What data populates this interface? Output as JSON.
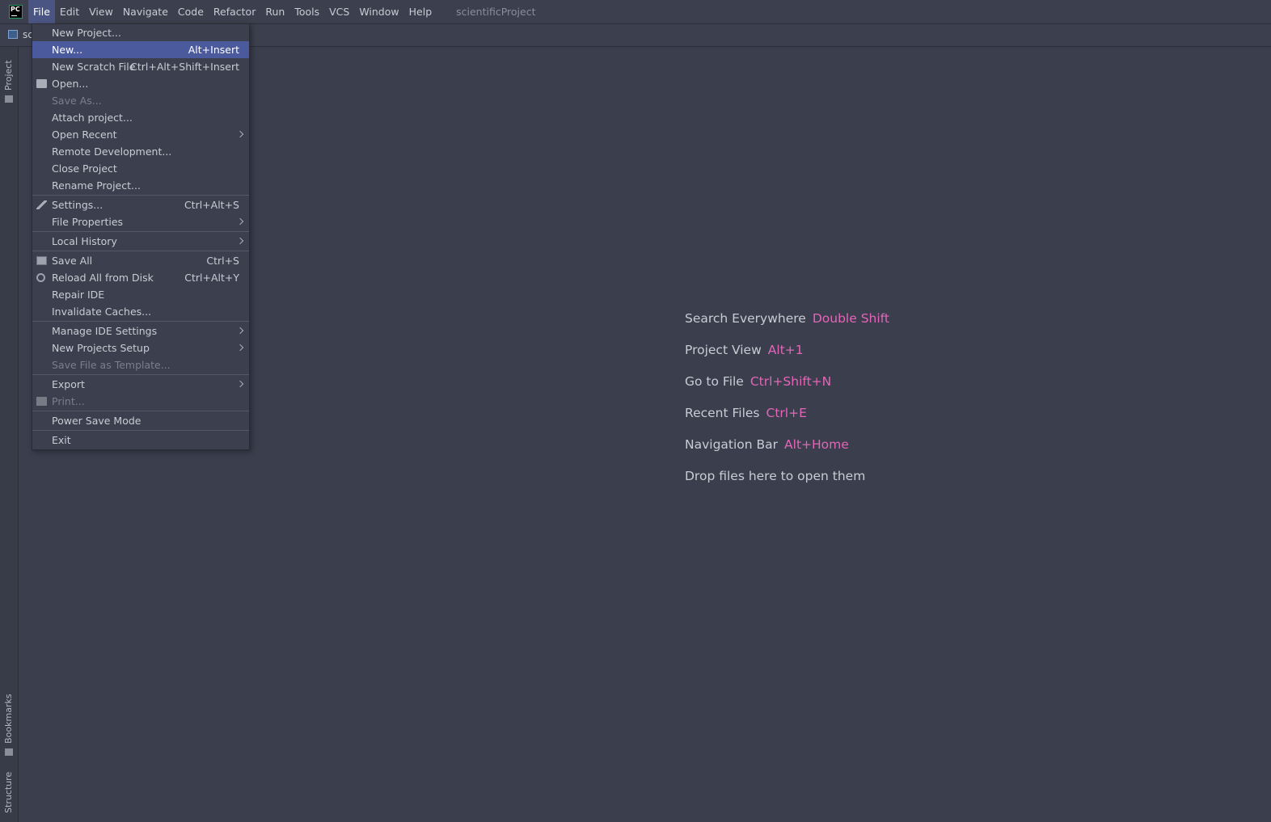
{
  "menubar": {
    "logo_text": "PC",
    "items": [
      "File",
      "Edit",
      "View",
      "Navigate",
      "Code",
      "Refactor",
      "Run",
      "Tools",
      "VCS",
      "Window",
      "Help"
    ],
    "project_title": "scientificProject"
  },
  "navbar": {
    "crumb": "sc"
  },
  "side_tabs": {
    "project": "Project",
    "bookmarks": "Bookmarks",
    "structure": "Structure"
  },
  "file_menu": {
    "new_project": "New Project...",
    "new": "New...",
    "new_shortcut": "Alt+Insert",
    "new_scratch": "New Scratch File",
    "new_scratch_shortcut": "Ctrl+Alt+Shift+Insert",
    "open": "Open...",
    "save_as": "Save As...",
    "attach_project": "Attach project...",
    "open_recent": "Open Recent",
    "remote_dev": "Remote Development...",
    "close_project": "Close Project",
    "rename_project": "Rename Project...",
    "settings": "Settings...",
    "settings_shortcut": "Ctrl+Alt+S",
    "file_properties": "File Properties",
    "local_history": "Local History",
    "save_all": "Save All",
    "save_all_shortcut": "Ctrl+S",
    "reload_all": "Reload All from Disk",
    "reload_all_shortcut": "Ctrl+Alt+Y",
    "repair_ide": "Repair IDE",
    "invalidate_caches": "Invalidate Caches...",
    "manage_ide_settings": "Manage IDE Settings",
    "new_projects_setup": "New Projects Setup",
    "save_file_template": "Save File as Template...",
    "export": "Export",
    "print": "Print...",
    "power_save": "Power Save Mode",
    "exit": "Exit"
  },
  "hints": {
    "search_label": "Search Everywhere",
    "search_key": "Double Shift",
    "project_label": "Project View",
    "project_key": "Alt+1",
    "goto_label": "Go to File",
    "goto_key": "Ctrl+Shift+N",
    "recent_label": "Recent Files",
    "recent_key": "Ctrl+E",
    "navbar_label": "Navigation Bar",
    "navbar_key": "Alt+Home",
    "drop_label": "Drop files here to open them"
  },
  "colors": {
    "accent": "#4b5a9d",
    "hint_key": "#e266b7",
    "background": "#3a3e4d"
  }
}
